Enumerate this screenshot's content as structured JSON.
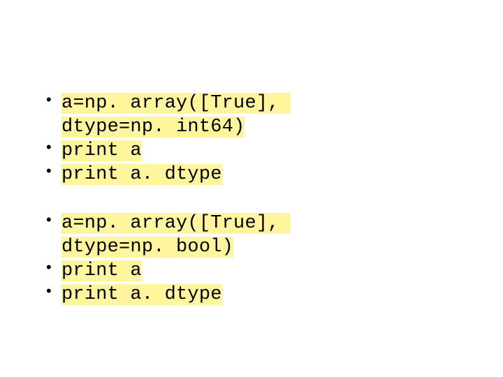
{
  "block1": {
    "items": [
      {
        "line1": "a=np. array([True], ",
        "line2": "dtype=np. int64)"
      },
      {
        "line1": "print a"
      },
      {
        "line1": "print a. dtype"
      }
    ]
  },
  "block2": {
    "items": [
      {
        "line1": "a=np. array([True], ",
        "line2": "dtype=np. bool)"
      },
      {
        "line1": "print a"
      },
      {
        "line1": "print a. dtype"
      }
    ]
  }
}
